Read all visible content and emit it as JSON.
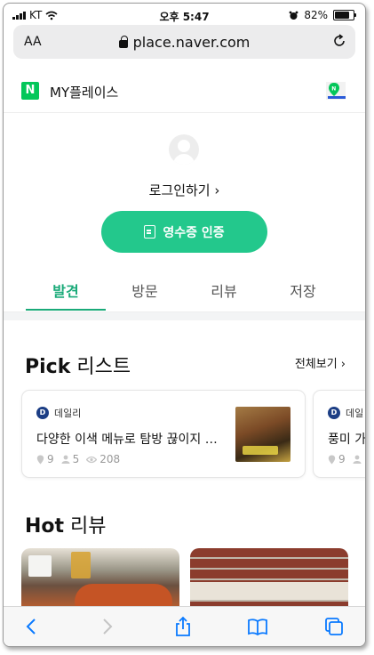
{
  "status": {
    "carrier": "KT",
    "time": "오후 5:47",
    "battery": "82%"
  },
  "browser": {
    "aa_label": "AA",
    "url": "place.naver.com"
  },
  "app": {
    "logo_letter": "N",
    "title": "MY플레이스"
  },
  "profile": {
    "login_label": "로그인하기 ›",
    "receipt_button": "영수증 인증"
  },
  "tabs": [
    {
      "label": "발견",
      "active": true
    },
    {
      "label": "방문",
      "active": false
    },
    {
      "label": "리뷰",
      "active": false
    },
    {
      "label": "저장",
      "active": false
    }
  ],
  "pick": {
    "title_bold": "Pick",
    "title_rest": " 리스트",
    "see_all": "전체보기 ›",
    "cards": [
      {
        "source": "데일리",
        "title": "다양한 이색 메뉴로 탐방 끊이지 …",
        "places": "9",
        "users": "5",
        "views": "208"
      },
      {
        "source": "데일",
        "title": "풍미 가",
        "places": "9",
        "users": "",
        "views": ""
      }
    ]
  },
  "hot": {
    "title_bold": "Hot",
    "title_rest": " 리뷰"
  },
  "colors": {
    "accent": "#23c88c",
    "tab_active": "#1aaa79",
    "naver_green": "#03c75a",
    "ios_blue": "#0a7aff"
  }
}
